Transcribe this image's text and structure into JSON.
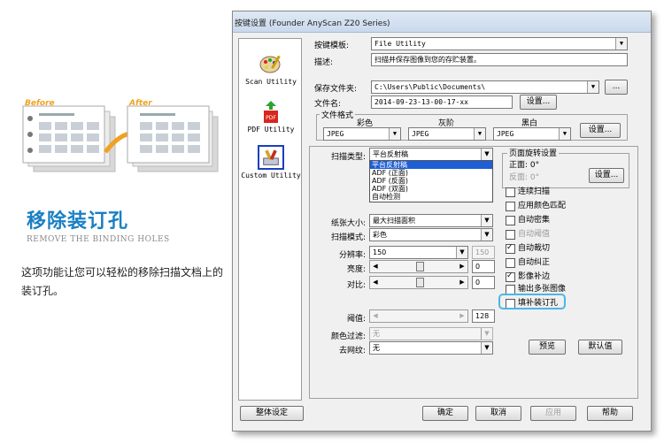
{
  "promo": {
    "before_label": "Before",
    "after_label": "After",
    "title": "移除装订孔",
    "subtitle": "REMOVE THE BINDING HOLES",
    "description": "这项功能让您可以轻松的移除扫描文档上的装订孔。"
  },
  "window": {
    "title": "按键设置 (Founder AnyScan Z20 Series)"
  },
  "modes": [
    {
      "label": "Scan Utility"
    },
    {
      "label": "PDF Utility",
      "badge": "PDF"
    },
    {
      "label": "Custom Utility",
      "selected": true
    }
  ],
  "template": {
    "label": "按键模板:",
    "value": "File Utility"
  },
  "description": {
    "label": "描述:",
    "value": "扫描并保存图像到您的存贮装置。"
  },
  "save_folder": {
    "label": "保存文件夹:",
    "value": "C:\\Users\\Public\\Documents\\",
    "browse": "..."
  },
  "file_name": {
    "label": "文件名:",
    "value": "2014-09-23-13-00-17-xx",
    "settings": "设置..."
  },
  "file_format": {
    "legend": "文件格式",
    "color_label": "彩色",
    "color_value": "JPEG",
    "gray_label": "灰阶",
    "gray_value": "JPEG",
    "bw_label": "黑白",
    "bw_value": "JPEG",
    "settings": "设置..."
  },
  "scan_type": {
    "label": "扫描类型:",
    "value": "平台反射稿",
    "options": [
      "平台反射稿",
      "ADF (正面)",
      "ADF (反面)",
      "ADF (双面)",
      "自动检测"
    ]
  },
  "rotation": {
    "legend": "页面旋转设置",
    "front": "正面: 0°",
    "back": "反面: 0°",
    "settings": "设置..."
  },
  "options": [
    {
      "label": "连续扫描",
      "checked": false,
      "enabled": true
    },
    {
      "label": "应用颜色匹配",
      "checked": false,
      "enabled": true
    },
    {
      "label": "自动密集",
      "checked": false,
      "enabled": true
    },
    {
      "label": "自动阈值",
      "checked": false,
      "enabled": false
    },
    {
      "label": "自动裁切",
      "checked": true,
      "enabled": true
    },
    {
      "label": "自动纠正",
      "checked": false,
      "enabled": true
    },
    {
      "label": "影像补边",
      "checked": true,
      "enabled": true
    },
    {
      "label": "输出多张图像",
      "checked": false,
      "enabled": true
    },
    {
      "label": "填补装订孔",
      "checked": false,
      "enabled": true
    }
  ],
  "paper_size": {
    "label": "纸张大小:",
    "value": "最大扫描面积"
  },
  "scan_mode": {
    "label": "扫描模式:",
    "value": "彩色"
  },
  "resolution": {
    "label": "分辨率:",
    "value": "150",
    "value2": "150"
  },
  "brightness": {
    "label": "亮度:",
    "value": "0",
    "level": 0.5
  },
  "contrast": {
    "label": "对比:",
    "value": "0",
    "level": 0.5
  },
  "threshold": {
    "label": "阈值:",
    "value": "128"
  },
  "color_filter": {
    "label": "颜色过滤:",
    "value": "无"
  },
  "descreen": {
    "label": "去网纹:",
    "value": "无"
  },
  "buttons": {
    "preview": "预览",
    "defaults": "默认值",
    "global": "整体设定",
    "ok": "确定",
    "cancel": "取消",
    "apply": "应用",
    "help": "帮助"
  },
  "colors": {
    "accent": "#1a7fc4",
    "highlight": "#4bb6e6",
    "selection": "#1e5fd6"
  }
}
